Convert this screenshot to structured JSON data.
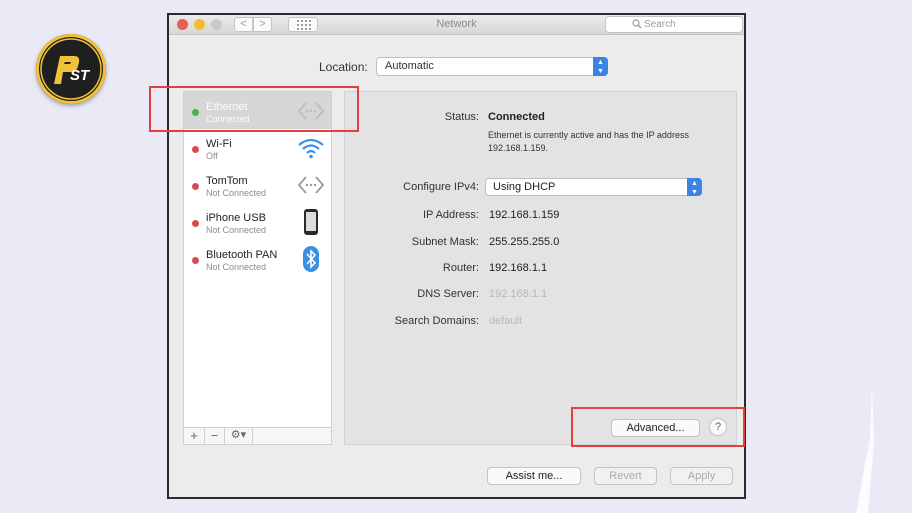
{
  "logo": {
    "text": "PST"
  },
  "window": {
    "title": "Network",
    "search_placeholder": "Search",
    "nav_back": "<",
    "nav_forward": ">"
  },
  "location": {
    "label": "Location:",
    "value": "Automatic"
  },
  "services": [
    {
      "name": "Ethernet",
      "status": "Connected",
      "dot": "green",
      "icon": "ethernet-icon",
      "selected": true
    },
    {
      "name": "Wi-Fi",
      "status": "Off",
      "dot": "red",
      "icon": "wifi-icon",
      "selected": false
    },
    {
      "name": "TomTom",
      "status": "Not Connected",
      "dot": "red",
      "icon": "ethernet-icon",
      "selected": false
    },
    {
      "name": "iPhone USB",
      "status": "Not Connected",
      "dot": "red",
      "icon": "iphone-icon",
      "selected": false
    },
    {
      "name": "Bluetooth PAN",
      "status": "Not Connected",
      "dot": "red",
      "icon": "bluetooth-icon",
      "selected": false
    }
  ],
  "sidebar_tools": {
    "add": "+",
    "remove": "−",
    "gear": "⚙▾"
  },
  "detail": {
    "status_label": "Status:",
    "status_value": "Connected",
    "status_description": "Ethernet is currently active and has the IP address 192.168.1.159.",
    "configure_label": "Configure IPv4:",
    "configure_value": "Using DHCP",
    "ip_label": "IP Address:",
    "ip_value": "192.168.1.159",
    "subnet_label": "Subnet Mask:",
    "subnet_value": "255.255.255.0",
    "router_label": "Router:",
    "router_value": "192.168.1.1",
    "dns_label": "DNS Server:",
    "dns_value": "192.168.1.1",
    "search_domains_label": "Search Domains:",
    "search_domains_value": "default",
    "advanced_button": "Advanced...",
    "help_button": "?"
  },
  "footer": {
    "assist": "Assist me...",
    "revert": "Revert",
    "apply": "Apply"
  },
  "colors": {
    "highlight": "#e2403f",
    "accent": "#3b84e6",
    "connected": "#49b64a",
    "disconnected": "#d94b52"
  }
}
